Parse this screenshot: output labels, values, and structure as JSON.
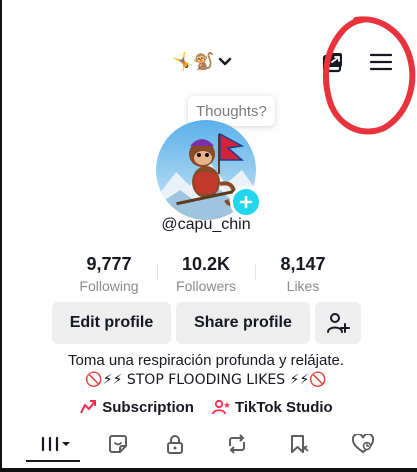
{
  "header": {
    "account_name_emoji": "🤸🐒",
    "chevron": "chevron-down-icon",
    "share_icon": "share-profile-icon",
    "menu_icon": "hamburger-menu-icon"
  },
  "annotation": {
    "color": "#e8333d"
  },
  "thoughts": {
    "label": "Thoughts?"
  },
  "profile": {
    "username": "@capu_chin",
    "stats": [
      {
        "value": "9,777",
        "label": "Following"
      },
      {
        "value": "10.2K",
        "label": "Followers"
      },
      {
        "value": "8,147",
        "label": "Likes"
      }
    ]
  },
  "actions": {
    "edit_label": "Edit profile",
    "share_label": "Share profile",
    "add_friend_icon": "add-friend-icon"
  },
  "bio": {
    "line1": "Toma una respiración profunda y relájate.",
    "line2": "🚫⚡⚡ STOP FLOODING LIKES ⚡⚡🚫"
  },
  "links": {
    "subscription": "Subscription",
    "studio": "TikTok Studio"
  },
  "tabs": [
    "videos-grid-icon",
    "sticker-icon",
    "lock-icon",
    "repost-icon",
    "favorites-icon",
    "liked-icon"
  ],
  "colors": {
    "accent": "#fe2c55",
    "add_badge": "#20d5ec",
    "button_bg": "#eeeeef",
    "muted_text": "#8a8b91"
  }
}
